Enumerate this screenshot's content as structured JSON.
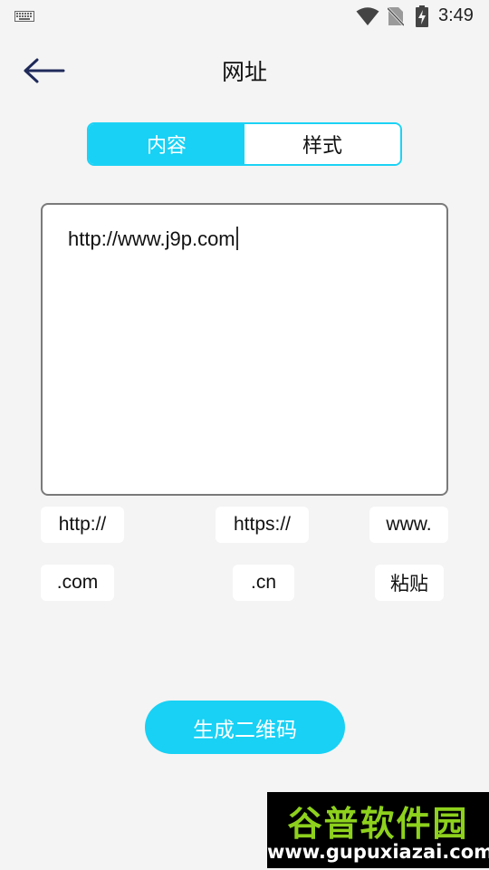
{
  "status_bar": {
    "time": "3:49",
    "icons": [
      "keyboard-icon",
      "wifi-icon",
      "no-sim-icon",
      "battery-charging-icon"
    ]
  },
  "header": {
    "title": "网址",
    "back_icon": "arrow-left-icon"
  },
  "tabs": [
    {
      "label": "内容",
      "active": true
    },
    {
      "label": "样式",
      "active": false
    }
  ],
  "input": {
    "value": "http://www.j9p.com"
  },
  "chips": {
    "http": "http://",
    "https": "https://",
    "www": "www.",
    "com": ".com",
    "cn": ".cn",
    "paste": "粘贴"
  },
  "actions": {
    "generate_label": "生成二维码"
  },
  "watermark": {
    "title": "谷普软件园",
    "url": "www.gupuxiazai.com"
  },
  "colors": {
    "accent": "#18d1f5",
    "background": "#f4f4f4",
    "watermark_green": "#8ed11d"
  }
}
